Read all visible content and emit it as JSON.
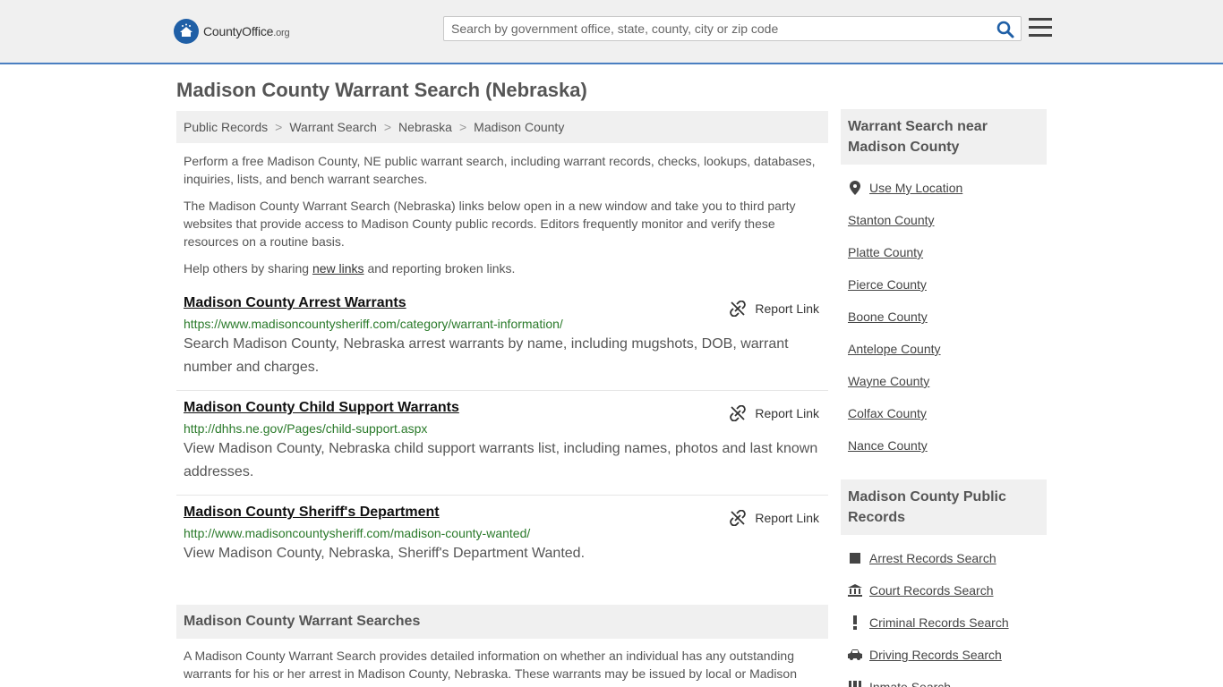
{
  "header": {
    "logo_brand": "CountyOffice",
    "logo_tld": ".org",
    "search_placeholder": "Search by government office, state, county, city or zip code"
  },
  "page_title": "Madison County Warrant Search (Nebraska)",
  "breadcrumb": [
    "Public Records",
    "Warrant Search",
    "Nebraska",
    "Madison County"
  ],
  "intro": {
    "p1": "Perform a free Madison County, NE public warrant search, including warrant records, checks, lookups, databases, inquiries, lists, and bench warrant searches.",
    "p2": "The Madison County Warrant Search (Nebraska) links below open in a new window and take you to third party websites that provide access to Madison County public records. Editors frequently monitor and verify these resources on a routine basis.",
    "p3_before": "Help others by sharing ",
    "p3_link": "new links",
    "p3_after": " and reporting broken links."
  },
  "report_label": "Report Link",
  "results": [
    {
      "title": "Madison County Arrest Warrants",
      "url": "https://www.madisoncountysheriff.com/category/warrant-information/",
      "desc": "Search Madison County, Nebraska arrest warrants by name, including mugshots, DOB, warrant number and charges."
    },
    {
      "title": "Madison County Child Support Warrants",
      "url": "http://dhhs.ne.gov/Pages/child-support.aspx",
      "desc": "View Madison County, Nebraska child support warrants list, including names, photos and last known addresses."
    },
    {
      "title": "Madison County Sheriff's Department",
      "url": "http://www.madisoncountysheriff.com/madison-county-wanted/",
      "desc": "View Madison County, Nebraska, Sheriff's Department Wanted."
    }
  ],
  "warrant_searches": {
    "heading": "Madison County Warrant Searches",
    "text": "A Madison County Warrant Search provides detailed information on whether an individual has any outstanding warrants for his or her arrest in Madison County, Nebraska. These warrants may be issued by local or Madison"
  },
  "sidebar": {
    "near_heading": "Warrant Search near Madison County",
    "use_location": "Use My Location",
    "near_items": [
      "Stanton County",
      "Platte County",
      "Pierce County",
      "Boone County",
      "Antelope County",
      "Wayne County",
      "Colfax County",
      "Nance County"
    ],
    "records_heading": "Madison County Public Records",
    "records_items": [
      {
        "label": "Arrest Records Search",
        "icon": "square-icon"
      },
      {
        "label": "Court Records Search",
        "icon": "courthouse-icon"
      },
      {
        "label": "Criminal Records Search",
        "icon": "exclamation-icon"
      },
      {
        "label": "Driving Records Search",
        "icon": "car-icon"
      },
      {
        "label": "Inmate Search",
        "icon": "inmate-icon"
      }
    ]
  }
}
